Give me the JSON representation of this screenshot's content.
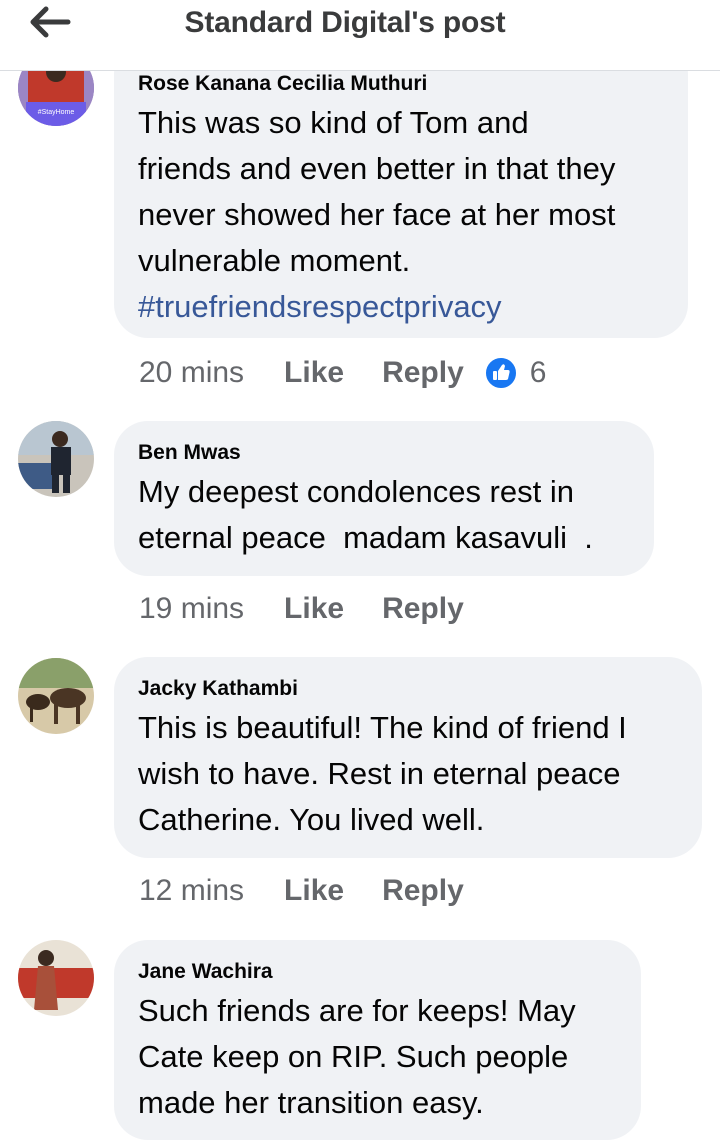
{
  "header": {
    "title": "Standard Digital's post"
  },
  "comments": [
    {
      "author": "Rose Kanana Cecilia Muthuri",
      "text": "This was so kind of Tom and\nfriends and even better in that they\nnever showed her face at her most\nvulnerable moment.",
      "hashtag": "#truefriendsrespectprivacy",
      "time": "20 mins",
      "like": "Like",
      "reply": "Reply",
      "reaction_count": "6",
      "avatar_badge": "#StayHome"
    },
    {
      "author": "Ben Mwas",
      "text": "My deepest condolences rest in\neternal peace  madam kasavuli  .",
      "time": "19 mins",
      "like": "Like",
      "reply": "Reply"
    },
    {
      "author": "Jacky Kathambi",
      "text": "This is beautiful! The kind of friend I\nwish to have. Rest in eternal peace\nCatherine. You lived well.",
      "time": "12 mins",
      "like": "Like",
      "reply": "Reply"
    },
    {
      "author": "Jane Wachira",
      "text": "Such friends are for keeps! May\nCate keep on RIP. Such people\nmade her transition easy."
    }
  ],
  "colors": {
    "bubble": "#f0f2f5",
    "meta": "#65676b",
    "hashtag": "#385898",
    "like_blue": "#1877f2"
  }
}
